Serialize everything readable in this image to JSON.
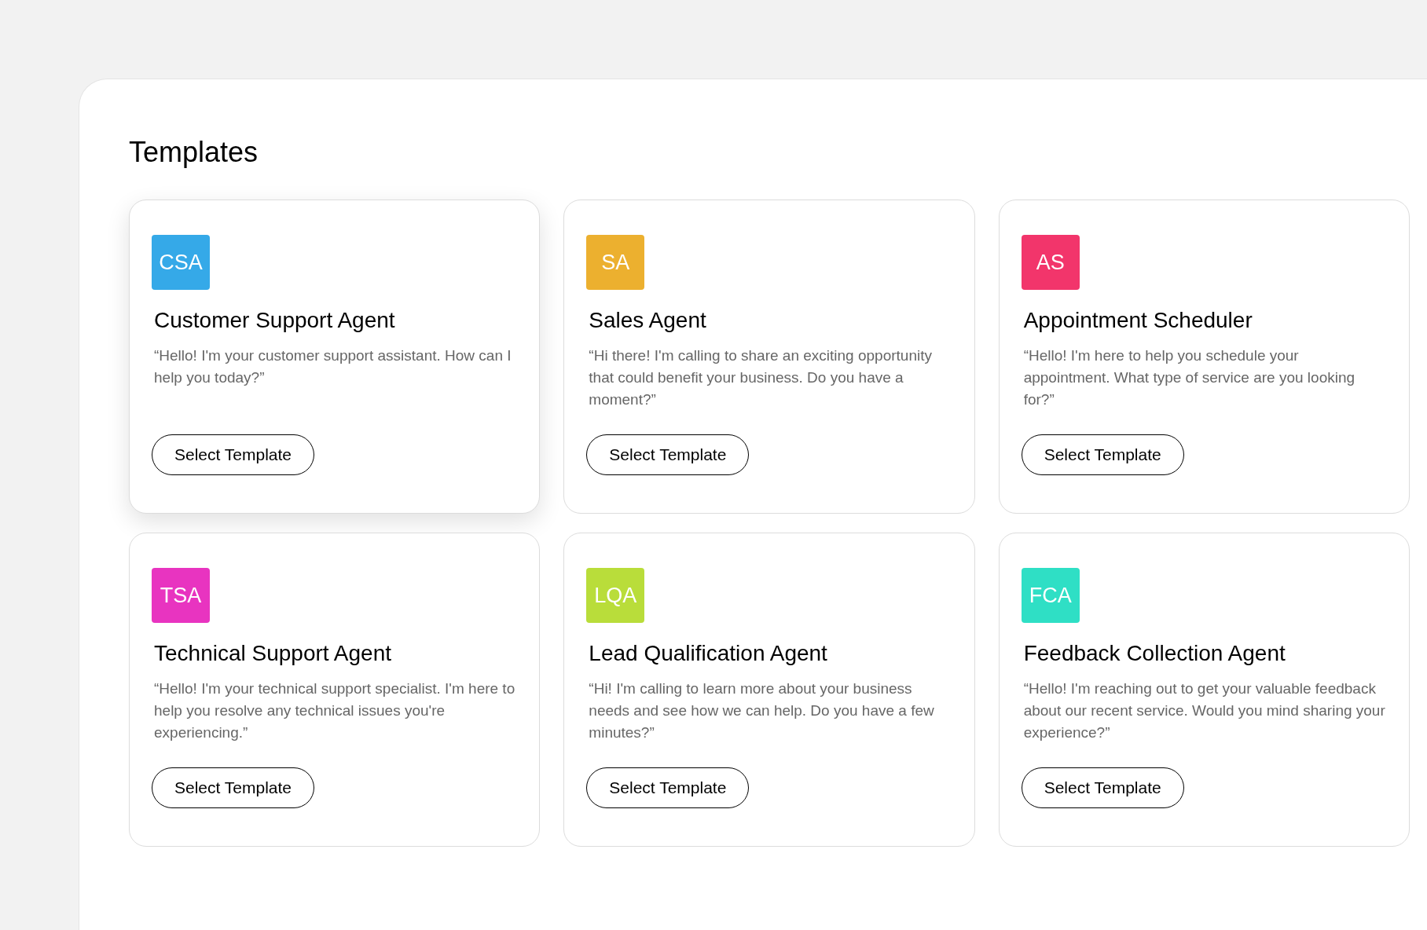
{
  "title": "Templates",
  "templates": [
    {
      "badge": "CSA",
      "color": "#35a9e8",
      "name": "Customer Support Agent",
      "greeting": "“Hello! I'm your customer support assistant. How can I help you today?”",
      "button": "Select Template",
      "raised": true
    },
    {
      "badge": "SA",
      "color": "#ecb02f",
      "name": "Sales Agent",
      "greeting": "“Hi there! I'm calling to share an exciting opportunity that could benefit your business. Do you have a moment?”",
      "button": "Select Template",
      "raised": false
    },
    {
      "badge": "AS",
      "color": "#f2356b",
      "name": "Appointment Scheduler",
      "greeting": "“Hello! I'm here to help you schedule your appointment. What type of service are you looking for?”",
      "button": "Select Template",
      "raised": false
    },
    {
      "badge": "TSA",
      "color": "#e834c0",
      "name": "Technical Support Agent",
      "greeting": "“Hello! I'm your technical support specialist. I'm here to help you resolve any technical issues you're experiencing.”",
      "button": "Select Template",
      "raised": false
    },
    {
      "badge": "LQA",
      "color": "#b9dd3a",
      "name": "Lead Qualification Agent",
      "greeting": "“Hi! I'm calling to learn more about your business needs and see how we can help. Do you have a few minutes?”",
      "button": "Select Template",
      "raised": false
    },
    {
      "badge": "FCA",
      "color": "#2fdfc5",
      "name": "Feedback Collection Agent",
      "greeting": "“Hello! I'm reaching out to get your valuable feedback about our recent service. Would you mind sharing your experience?”",
      "button": "Select Template",
      "raised": false
    }
  ]
}
